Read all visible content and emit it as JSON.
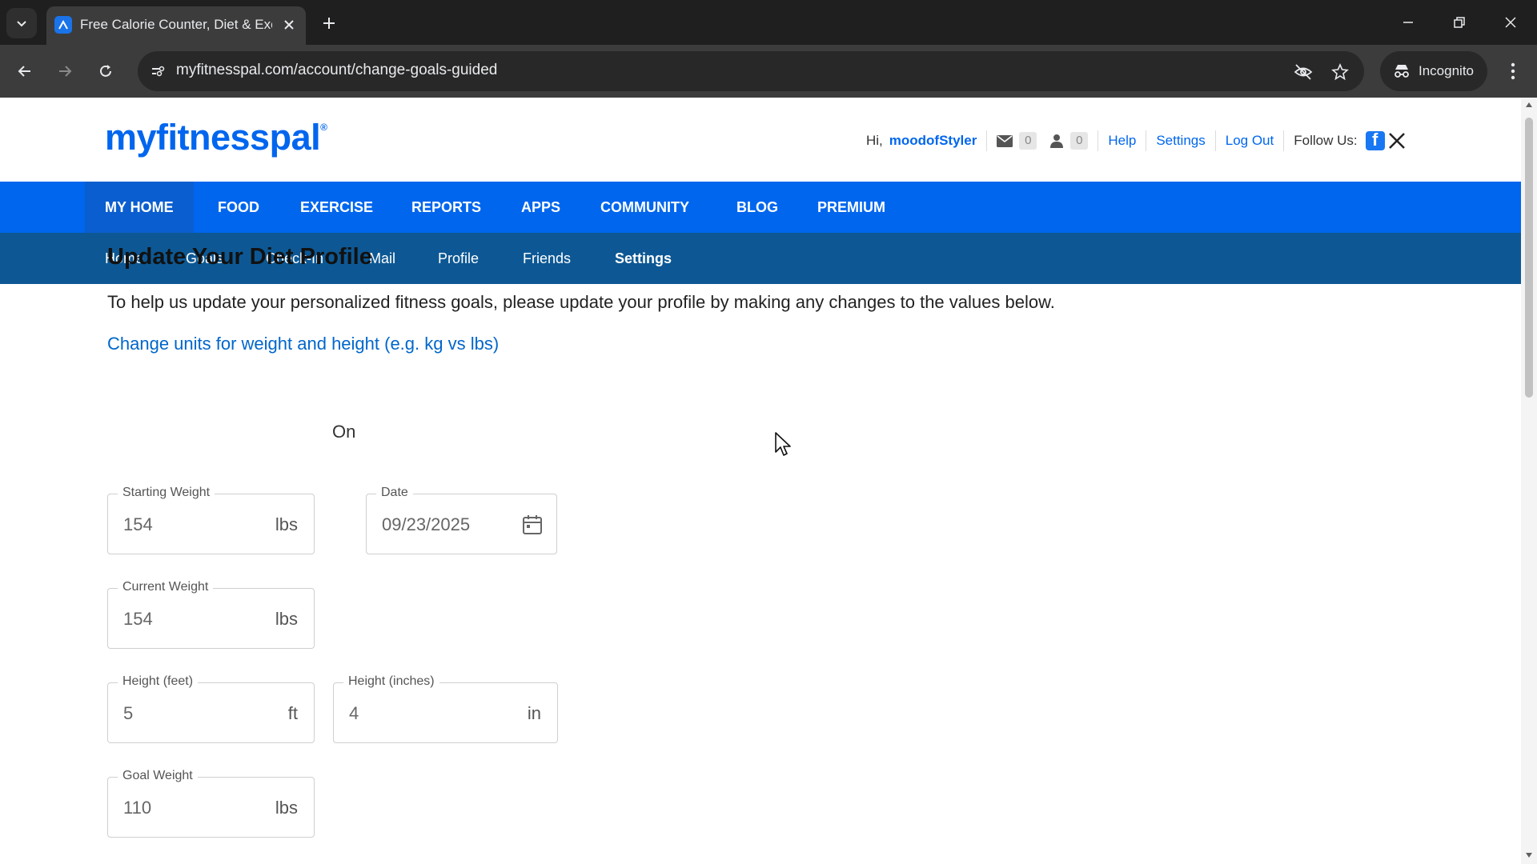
{
  "browser": {
    "tab_title": "Free Calorie Counter, Diet & Exercise Journal",
    "url": "myfitnesspal.com/account/change-goals-guided",
    "incognito_label": "Incognito"
  },
  "header": {
    "logo_text": "myfitnesspal",
    "greeting": "Hi,",
    "username": "moodofStyler",
    "mail_count": "0",
    "friend_count": "0",
    "help": "Help",
    "settings": "Settings",
    "logout": "Log Out",
    "follow_us": "Follow Us:"
  },
  "main_nav": {
    "items": [
      "MY HOME",
      "FOOD",
      "EXERCISE",
      "REPORTS",
      "APPS",
      "COMMUNITY",
      "BLOG",
      "PREMIUM"
    ],
    "active": "MY HOME"
  },
  "sub_nav": {
    "items": [
      "Home",
      "Goals",
      "Check-In",
      "Mail",
      "Profile",
      "Friends",
      "Settings"
    ],
    "active": "Settings"
  },
  "content": {
    "title": "Update Your Diet Profile",
    "intro": "To help us update your personalized fitness goals, please update your profile by making any changes to the values below.",
    "units_link": "Change units for weight and height (e.g. kg vs lbs)",
    "on_label": "On"
  },
  "form": {
    "starting_weight": {
      "label": "Starting Weight",
      "value": "154",
      "unit": "lbs"
    },
    "date": {
      "label": "Date",
      "value": "09/23/2025"
    },
    "current_weight": {
      "label": "Current Weight",
      "value": "154",
      "unit": "lbs"
    },
    "height_feet": {
      "label": "Height (feet)",
      "value": "5",
      "unit": "ft"
    },
    "height_inches": {
      "label": "Height (inches)",
      "value": "4",
      "unit": "in"
    },
    "goal_weight": {
      "label": "Goal Weight",
      "value": "110",
      "unit": "lbs"
    }
  },
  "colors": {
    "brand_blue": "#0066ee",
    "subnav_blue": "#0d5894",
    "link_blue": "#0066cc"
  }
}
